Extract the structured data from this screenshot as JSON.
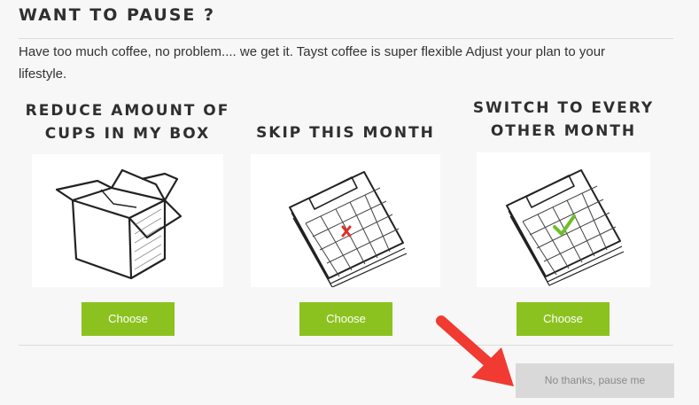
{
  "header": {
    "title": "WANT TO PAUSE ?",
    "intro": "Have too much coffee, no problem.... we get it. Tayst coffee is super flexible Adjust your plan to your lifestyle."
  },
  "options": [
    {
      "heading_line1": "REDUCE AMOUNT OF",
      "heading_line2": "CUPS IN MY BOX",
      "illustration": "open-box-icon",
      "button_label": "Choose"
    },
    {
      "heading_line1": "SKIP THIS MONTH",
      "heading_line2": "",
      "illustration": "calendar-x-icon",
      "button_label": "Choose"
    },
    {
      "heading_line1": "SWITCH TO EVERY",
      "heading_line2": "OTHER MONTH",
      "illustration": "calendar-check-icon",
      "button_label": "Choose"
    }
  ],
  "pause_button_label": "No thanks, pause me",
  "colors": {
    "choose_button": "#8cc21f",
    "pause_button": "#d9d9d9",
    "arrow": "#f03a32",
    "check_mark": "#6fbf2a",
    "x_mark": "#e0302a"
  }
}
